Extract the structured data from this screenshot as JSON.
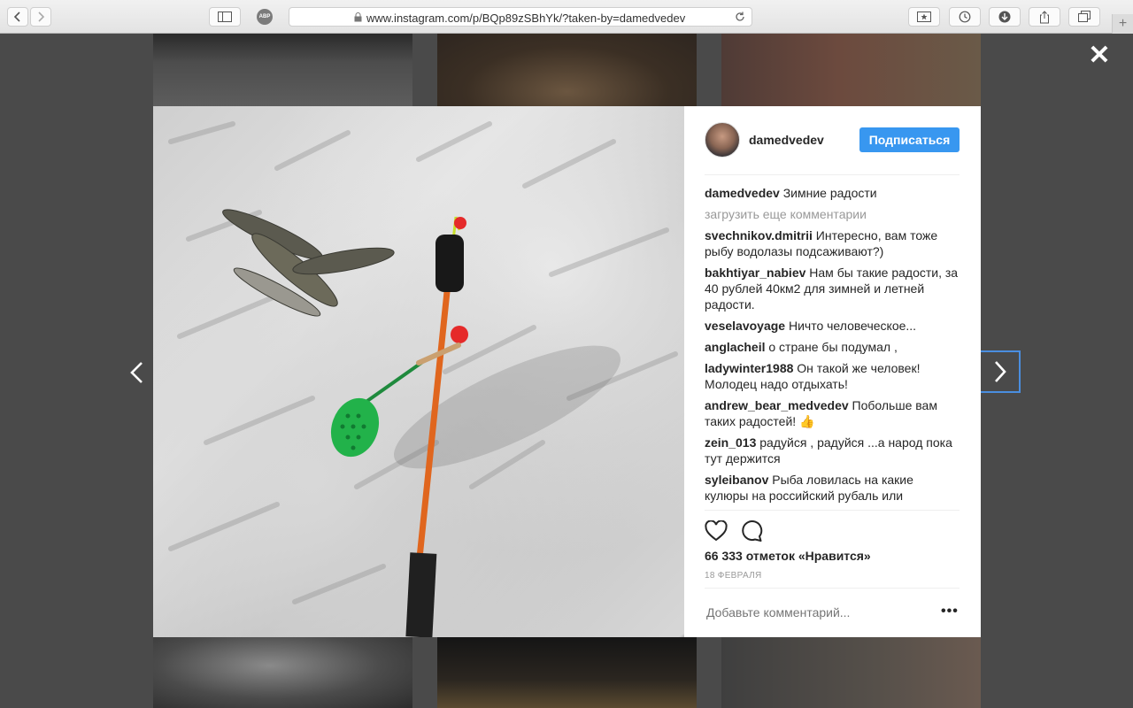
{
  "browser": {
    "url": "www.instagram.com/p/BQp89zSBhYk/?taken-by=damedvedev",
    "adblock_label": "ABP",
    "new_tab_label": "+"
  },
  "overlay": {
    "close_label": "✕"
  },
  "post": {
    "username": "damedvedev",
    "follow_label": "Подписаться",
    "caption": {
      "user": "damedvedev",
      "text": "Зимние радости"
    },
    "load_more": "загрузить еще комментарии",
    "comments": [
      {
        "user": "svechnikov.dmitrii",
        "text": "Интересно, вам тоже рыбу водолазы подсаживают?)"
      },
      {
        "user": "bakhtiyar_nabiev",
        "text": "Нам бы такие радости, за 40 рублей 40км2 для зимней и летней радости."
      },
      {
        "user": "veselavoyage",
        "text": "Ничто человеческое..."
      },
      {
        "user": "anglacheil",
        "text": "о стране бы подумал ,"
      },
      {
        "user": "ladywinter1988",
        "text": "Он такой же человек! Молодец надо отдыхать!"
      },
      {
        "user": "andrew_bear_medvedev",
        "text": "Побольше вам таких радостей! 👍"
      },
      {
        "user": "zein_013",
        "text": "радуйся , радуйся ...а народ пока тут держится"
      },
      {
        "user": "syleibanov",
        "text": "Рыба ловилась на какие кулюры на российский рубаль или"
      }
    ],
    "likes": "66 333 отметок «Нравится»",
    "date": "18 ФЕВРАЛЯ",
    "add_comment_placeholder": "Добавьте комментарий...",
    "more_label": "•••"
  },
  "colors": {
    "follow_button": "#3897f0",
    "backdrop": "#4a4a4a",
    "next_focus": "#4a8ee0"
  },
  "icons": [
    "back-icon",
    "forward-icon",
    "sidebar-icon",
    "lock-icon",
    "reload-icon",
    "bookmarks-icon",
    "history-icon",
    "downloads-icon",
    "share-icon",
    "tabs-icon",
    "close-icon",
    "chevron-left-icon",
    "chevron-right-icon",
    "heart-icon",
    "comment-icon"
  ]
}
